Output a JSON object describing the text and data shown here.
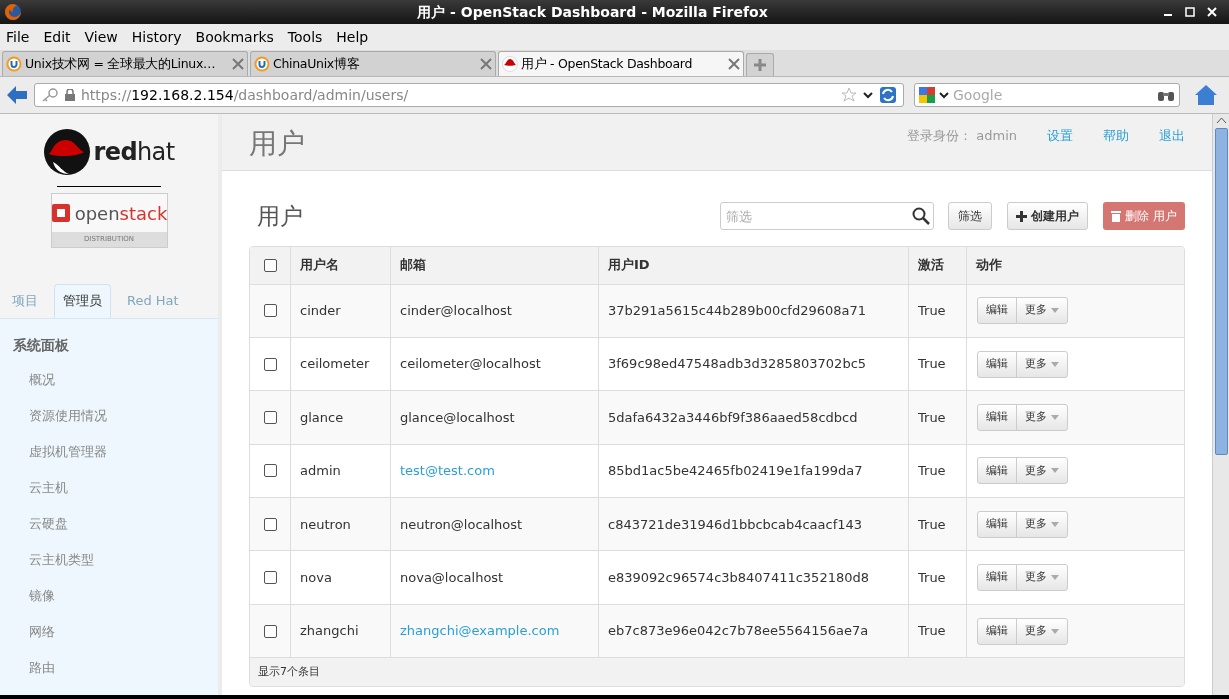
{
  "window": {
    "title": "用户 - OpenStack Dashboard - Mozilla Firefox"
  },
  "menu": [
    "File",
    "Edit",
    "View",
    "History",
    "Bookmarks",
    "Tools",
    "Help"
  ],
  "tabs": [
    {
      "label": "Unix技术网 = 全球最大的Linux…",
      "selected": false,
      "kind": "u"
    },
    {
      "label": "ChinaUnix博客",
      "selected": false,
      "kind": "u"
    },
    {
      "label": "用户 - OpenStack Dashboard",
      "selected": true,
      "kind": "hat"
    }
  ],
  "address_bar": {
    "scheme": "https://",
    "host": "192.168.2.154",
    "path": "/dashboard/admin/users/"
  },
  "search": {
    "placeholder": "Google"
  },
  "sidebar": {
    "brand_bold": "red",
    "brand_rest": "hat",
    "product_gray": "open",
    "product_red": "stack",
    "product_sub": "DISTRIBUTION",
    "tabs": [
      {
        "label": "项目",
        "selected": false
      },
      {
        "label": "管理员",
        "selected": true
      },
      {
        "label": "Red Hat",
        "selected": false
      }
    ],
    "panel_title": "系统面板",
    "items": [
      "概况",
      "资源使用情况",
      "虚拟机管理器",
      "云主机",
      "云硬盘",
      "云主机类型",
      "镜像",
      "网络",
      "路由"
    ]
  },
  "header": {
    "title": "用户",
    "login_label": "登录身份：",
    "user": "admin",
    "links": [
      "设置",
      "帮助",
      "退出"
    ]
  },
  "content": {
    "title": "用户",
    "filter": {
      "placeholder": "筛选"
    },
    "filter_button": "筛选",
    "create_button": "创建用户",
    "delete_button": {
      "label": "删除 用户",
      "disabled": true
    }
  },
  "table": {
    "select_all_checked": false,
    "columns": [
      "用户名",
      "邮箱",
      "用户ID",
      "激活",
      "动作"
    ],
    "rows": [
      {
        "checked": false,
        "username": "cinder",
        "email": "cinder@localhost",
        "link": false,
        "id": "37b291a5615c44b289b00cfd29608a71",
        "active": "True",
        "actions": [
          "编辑",
          "更多"
        ]
      },
      {
        "checked": false,
        "username": "ceilometer",
        "email": "ceilometer@localhost",
        "link": false,
        "id": "3f69c98ed47548adb3d3285803702bc5",
        "active": "True",
        "actions": [
          "编辑",
          "更多"
        ]
      },
      {
        "checked": false,
        "username": "glance",
        "email": "glance@localhost",
        "link": false,
        "id": "5dafa6432a3446bf9f386aaed58cdbcd",
        "active": "True",
        "actions": [
          "编辑",
          "更多"
        ]
      },
      {
        "checked": false,
        "username": "admin",
        "email": "test@test.com",
        "link": true,
        "id": "85bd1ac5be42465fb02419e1fa199da7",
        "active": "True",
        "actions": [
          "编辑",
          "更多"
        ]
      },
      {
        "checked": false,
        "username": "neutron",
        "email": "neutron@localhost",
        "link": false,
        "id": "c843721de31946d1bbcbcab4caacf143",
        "active": "True",
        "actions": [
          "编辑",
          "更多"
        ]
      },
      {
        "checked": false,
        "username": "nova",
        "email": "nova@localhost",
        "link": false,
        "id": "e839092c96574c3b8407411c352180d8",
        "active": "True",
        "actions": [
          "编辑",
          "更多"
        ]
      },
      {
        "checked": false,
        "username": "zhangchi",
        "email": "zhangchi@example.com",
        "link": true,
        "id": "eb7c873e96e042c7b78ee5564156ae7a",
        "active": "True",
        "actions": [
          "编辑",
          "更多"
        ]
      }
    ],
    "footer": "显示7个条目"
  }
}
